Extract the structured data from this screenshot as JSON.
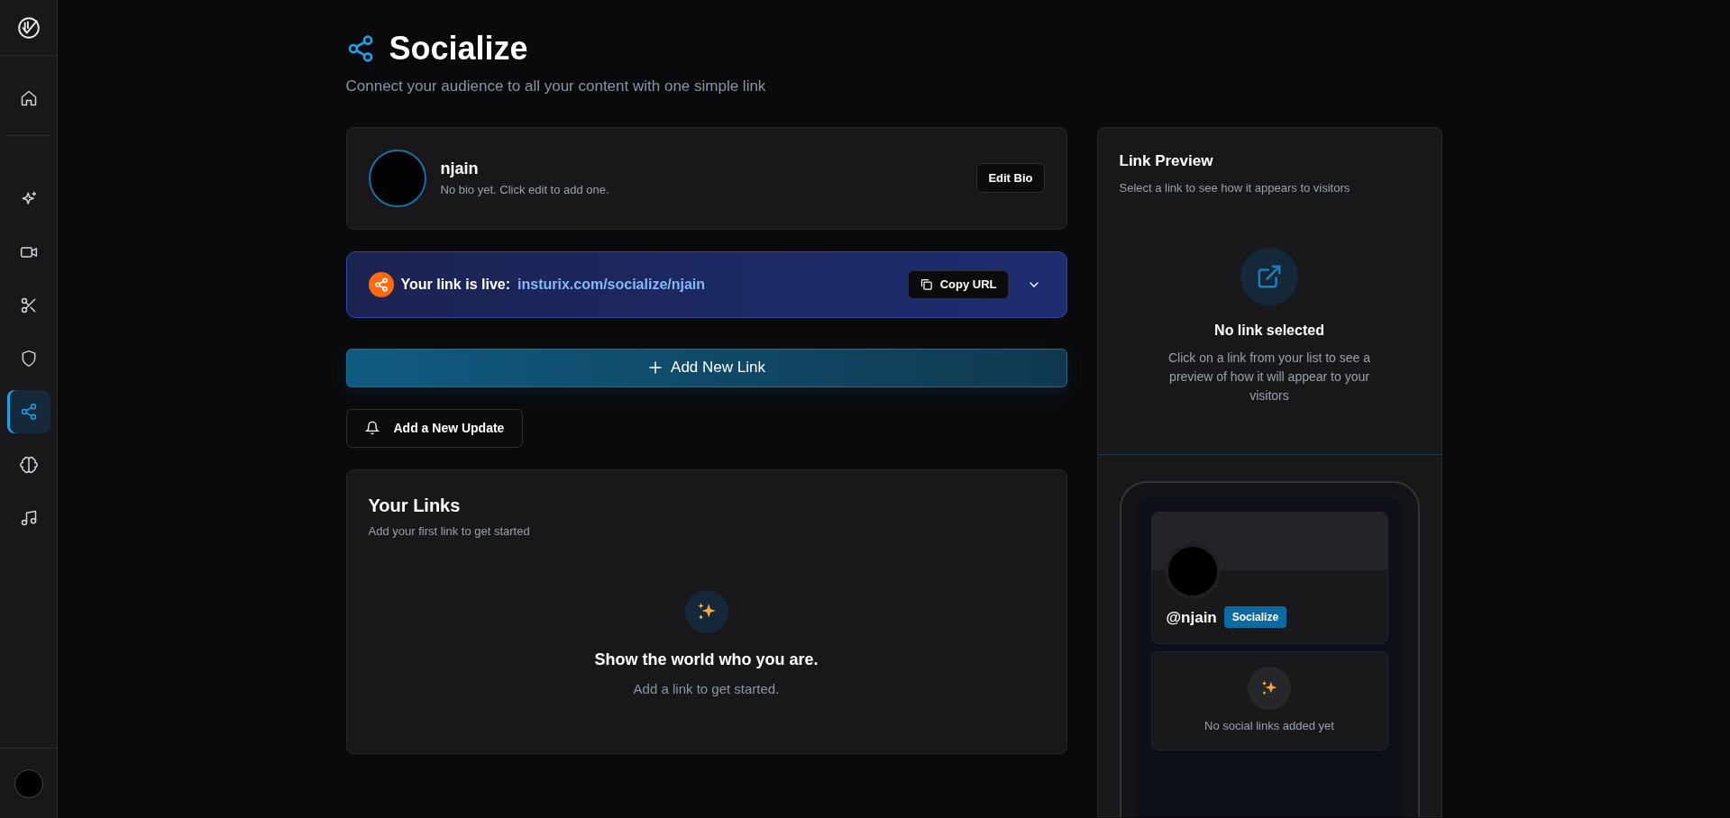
{
  "sidebar": {
    "items": [
      {
        "kind": "home",
        "selected": false
      },
      {
        "kind": "sparkles",
        "selected": false
      },
      {
        "kind": "video",
        "selected": false
      },
      {
        "kind": "scissors",
        "selected": false
      },
      {
        "kind": "shield",
        "selected": false
      },
      {
        "kind": "share",
        "selected": true
      },
      {
        "kind": "brain",
        "selected": false
      },
      {
        "kind": "music",
        "selected": false
      }
    ]
  },
  "header": {
    "title": "Socialize",
    "subtitle": "Connect your audience to all your content with one simple link"
  },
  "profile": {
    "name": "njain",
    "bio": "No bio yet. Click edit to add one.",
    "edit_button": "Edit Bio"
  },
  "live_link": {
    "label": "Your link is live:",
    "url": "insturix.com/socialize/njain",
    "copy_button": "Copy URL",
    "expanded": false
  },
  "add_link_button": "Add New Link",
  "add_update_button": "Add a New Update",
  "links": {
    "title": "Your Links",
    "subtitle": "Add your first link to get started",
    "empty_title": "Show the world who you are.",
    "empty_text": "Add a link to get started."
  },
  "preview": {
    "title": "Link Preview",
    "subtitle": "Select a link to see how it appears to visitors",
    "empty_title": "No link selected",
    "empty_text": "Click on a link from your list to see a preview of how it will appear to your visitors",
    "phone": {
      "handle": "@njain",
      "badge": "Socialize",
      "empty_text": "No social links added yet"
    }
  }
}
